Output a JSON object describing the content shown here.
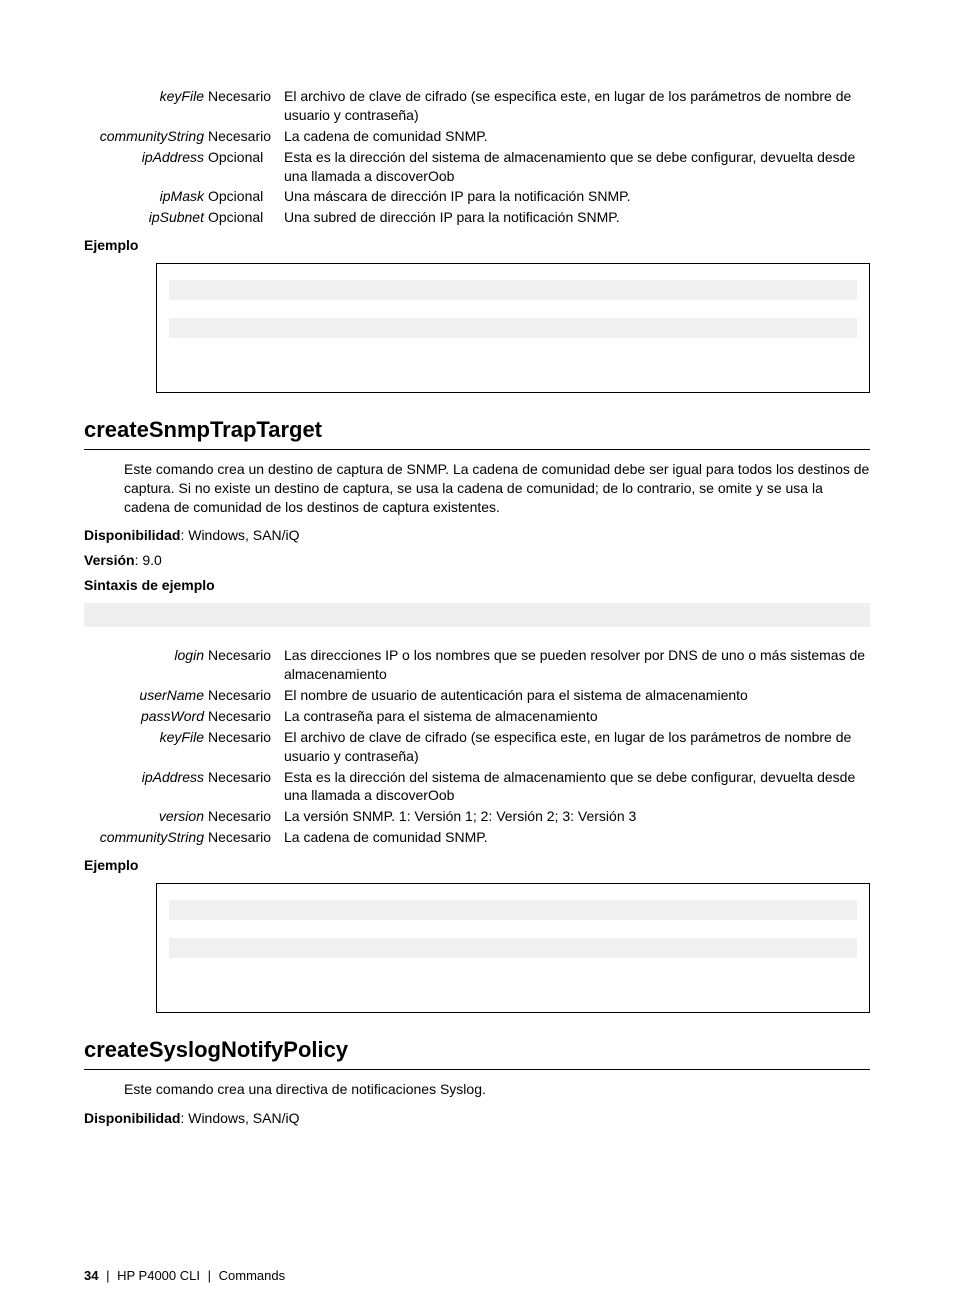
{
  "topParams": [
    {
      "name": "keyFile",
      "req": "Necesario",
      "desc": "El archivo de clave de cifrado (se especifica este, en lugar de los parámetros de nombre de usuario y contraseña)"
    },
    {
      "name": "communityString",
      "req": "Necesario",
      "desc": "La cadena de comunidad SNMP."
    },
    {
      "name": "ipAddress",
      "req": "Opcional",
      "desc": "Esta es la dirección del sistema de almacenamiento que se debe configurar, devuelta desde una llamada a discoverOob"
    },
    {
      "name": "ipMask",
      "req": "Opcional",
      "desc": "Una máscara de dirección IP para la notificación SNMP."
    },
    {
      "name": "ipSubnet",
      "req": "Opcional",
      "desc": "Una subred de dirección IP para la notificación SNMP."
    }
  ],
  "labels": {
    "ejemplo": "Ejemplo",
    "disponibilidad": "Disponibilidad",
    "version": "Versión",
    "sintaxis": "Sintaxis de ejemplo"
  },
  "section1": {
    "heading": "createSnmpTrapTarget",
    "intro": "Este comando crea un destino de captura de SNMP. La cadena de comunidad debe ser igual para todos los destinos de captura. Si no existe un destino de captura, se usa la cadena de comunidad; de lo contrario, se omite y se usa la cadena de comunidad de los destinos de captura existentes.",
    "disponibilidad": ": Windows, SAN/iQ",
    "version": ": 9.0",
    "params": [
      {
        "name": "login",
        "req": "Necesario",
        "desc": "Las direcciones IP o los nombres que se pueden resolver por DNS de uno o más sistemas de almacenamiento"
      },
      {
        "name": "userName",
        "req": "Necesario",
        "desc": "El nombre de usuario de autenticación para el sistema de almacenamiento"
      },
      {
        "name": "passWord",
        "req": "Necesario",
        "desc": "La contraseña para el sistema de almacenamiento"
      },
      {
        "name": "keyFile",
        "req": "Necesario",
        "desc": "El archivo de clave de cifrado (se especifica este, en lugar de los parámetros de nombre de usuario y contraseña)"
      },
      {
        "name": "ipAddress",
        "req": "Necesario",
        "desc": "Esta es la dirección del sistema de almacenamiento que se debe configurar, devuelta desde una llamada a discoverOob"
      },
      {
        "name": "version",
        "req": "Necesario",
        "desc": "La versión SNMP. 1: Versión 1; 2: Versión 2; 3: Versión 3"
      },
      {
        "name": "communityString",
        "req": "Necesario",
        "desc": "La cadena de comunidad SNMP."
      }
    ]
  },
  "section2": {
    "heading": "createSyslogNotifyPolicy",
    "intro": "Este comando crea una directiva de notificaciones Syslog.",
    "disponibilidad": ": Windows, SAN/iQ"
  },
  "footer": {
    "page": "34",
    "product": "HP P4000 CLI",
    "section": "Commands"
  }
}
